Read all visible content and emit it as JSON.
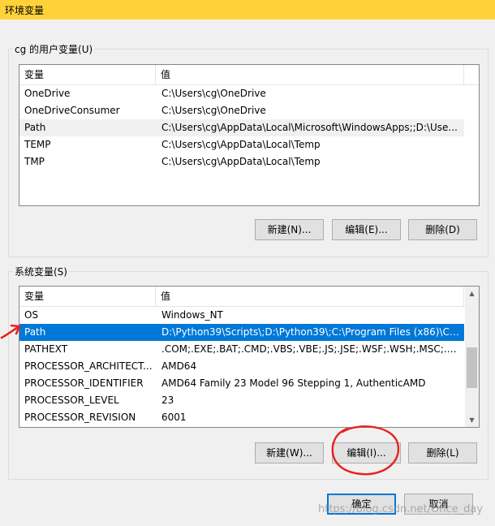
{
  "window": {
    "title": "环境变量"
  },
  "user_section": {
    "label": "cg 的用户变量(U)",
    "columns": [
      "变量",
      "值"
    ],
    "rows": [
      {
        "name": "OneDrive",
        "value": "C:\\Users\\cg\\OneDrive"
      },
      {
        "name": "OneDriveConsumer",
        "value": "C:\\Users\\cg\\OneDrive"
      },
      {
        "name": "Path",
        "value": "C:\\Users\\cg\\AppData\\Local\\Microsoft\\WindowsApps;;D:\\Use..."
      },
      {
        "name": "TEMP",
        "value": "C:\\Users\\cg\\AppData\\Local\\Temp"
      },
      {
        "name": "TMP",
        "value": "C:\\Users\\cg\\AppData\\Local\\Temp"
      }
    ],
    "buttons": {
      "new": "新建(N)...",
      "edit": "编辑(E)...",
      "delete": "删除(D)"
    }
  },
  "system_section": {
    "label": "系统变量(S)",
    "columns": [
      "变量",
      "值"
    ],
    "rows": [
      {
        "name": "OS",
        "value": "Windows_NT"
      },
      {
        "name": "Path",
        "value": "D:\\Python39\\Scripts\\;D:\\Python39\\;C:\\Program Files (x86)\\Co..."
      },
      {
        "name": "PATHEXT",
        "value": ".COM;.EXE;.BAT;.CMD;.VBS;.VBE;.JS;.JSE;.WSF;.WSH;.MSC;.PY;.P..."
      },
      {
        "name": "PROCESSOR_ARCHITECT...",
        "value": "AMD64"
      },
      {
        "name": "PROCESSOR_IDENTIFIER",
        "value": "AMD64 Family 23 Model 96 Stepping 1, AuthenticAMD"
      },
      {
        "name": "PROCESSOR_LEVEL",
        "value": "23"
      },
      {
        "name": "PROCESSOR_REVISION",
        "value": "6001"
      }
    ],
    "buttons": {
      "new": "新建(W)...",
      "edit": "编辑(I)...",
      "delete": "删除(L)"
    }
  },
  "dialog_buttons": {
    "ok": "确定",
    "cancel": "取消"
  },
  "watermark": "https://blog.csdn.net/Once_day",
  "colors": {
    "titlebar": "#ffd23a",
    "selection": "#0078d7",
    "annotation": "#e8211c"
  }
}
